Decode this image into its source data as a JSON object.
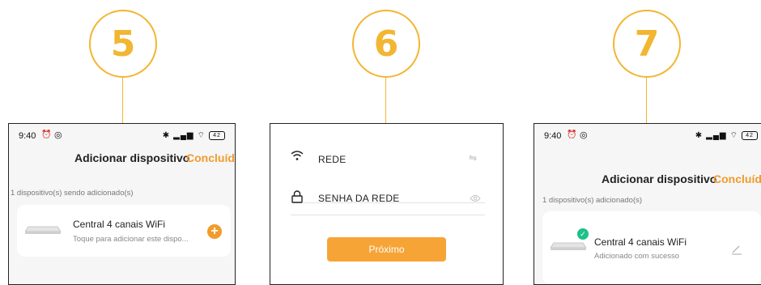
{
  "steps": [
    "5",
    "6",
    "7"
  ],
  "status_time": "9:40",
  "battery_level": "42",
  "screen5": {
    "title": "Adicionar dispositivo",
    "done": "Concluído",
    "section": "1 dispositivo(s) sendo adicionado(s)",
    "device_name": "Central 4 canais WiFi",
    "device_status": "Toque para adicionar este dispo..."
  },
  "screen6": {
    "network_label": "REDE",
    "password_label": "SENHA DA REDE",
    "next": "Próximo"
  },
  "screen7": {
    "title": "Adicionar dispositivo",
    "done": "Concluído",
    "section": "1 dispositivo(s) adicionado(s)",
    "device_name": "Central 4 canais WiFi",
    "device_status": "Adicionado com sucesso"
  },
  "colors": {
    "accent": "#f29b2d",
    "step": "#f2b632",
    "success": "#1bc28a"
  },
  "icons": [
    "wifi-icon",
    "swap-icon",
    "lock-icon",
    "eye-icon",
    "plus-icon",
    "check-icon",
    "edit-icon",
    "bluetooth-icon",
    "signal-icon",
    "alarm-icon",
    "whatsapp-icon"
  ]
}
